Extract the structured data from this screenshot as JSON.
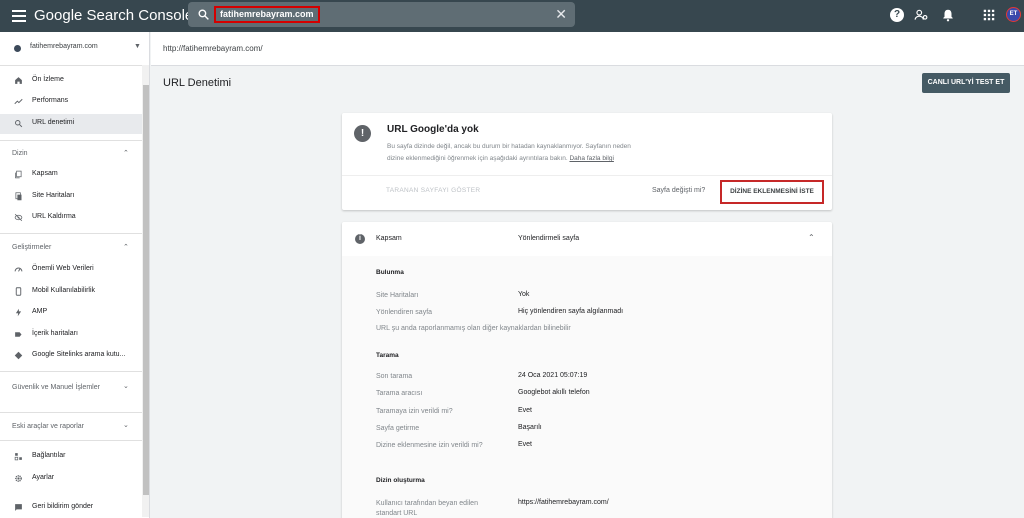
{
  "topbar": {
    "app_name": "Google Search Console",
    "search_value": "fatihemrebayram.com",
    "clear_symbol": "✕",
    "help_symbol": "?",
    "avatar_initials": "ET",
    "icons": [
      "menu-icon",
      "search-icon",
      "close-icon",
      "help-icon",
      "manage-users-icon",
      "notifications-icon",
      "apps-icon"
    ]
  },
  "sidebar": {
    "property": "fatihemrebayram.com",
    "property_caret": "▼",
    "top_items": [
      {
        "label": "Ön İzleme",
        "icon": "home-icon"
      },
      {
        "label": "Performans",
        "icon": "trending-up-icon"
      },
      {
        "label": "URL denetimi",
        "icon": "search-icon",
        "active": true
      }
    ],
    "section_index": "Dizin",
    "index_items": [
      {
        "label": "Kapsam",
        "icon": "file-copy-icon"
      },
      {
        "label": "Site Haritaları",
        "icon": "sitemap-icon"
      },
      {
        "label": "URL Kaldırma",
        "icon": "visibility-off-icon"
      }
    ],
    "section_enhancements": "Geliştirmeler",
    "enh_items": [
      {
        "label": "Önemli Web Verileri",
        "icon": "speed-icon"
      },
      {
        "label": "Mobil Kullanılabilirlik",
        "icon": "smartphone-icon"
      },
      {
        "label": "AMP",
        "icon": "bolt-icon"
      },
      {
        "label": "İçerik haritaları",
        "icon": "breadcrumb-icon"
      },
      {
        "label": "Google Sitelinks arama kutu...",
        "icon": "layers-icon"
      }
    ],
    "section_security": "Güvenlik ve Manuel İşlemler",
    "section_legacy": "Eski araçlar ve raporlar",
    "bottom_items": [
      {
        "label": "Bağlantılar",
        "icon": "links-icon"
      },
      {
        "label": "Ayarlar",
        "icon": "settings-icon"
      },
      {
        "label": "Geri bildirim gönder",
        "icon": "feedback-icon"
      }
    ],
    "chevron_up": "⌃",
    "chevron_down": "⌄"
  },
  "path": "http://fatihemrebayram.com/",
  "page_title": "URL Denetimi",
  "live_test_label": "CANLI URL'Yİ TEST ET",
  "status_card": {
    "icon_symbol": "!",
    "title": "URL Google'da yok",
    "desc_line1": "Bu sayfa dizinde değil, ancak bu durum bir hatadan kaynaklanmıyor. Sayfanın neden",
    "desc_line2": "dizine eklenmediğini öğrenmek için aşağıdaki ayrıntılara bakın.",
    "desc_link": "Daha fazla bilgi",
    "crawled_page_label": "TARANAN SAYFAYI GÖSTER",
    "page_changed_label": "Sayfa değişti mi?",
    "request_index_label": "DİZİNE EKLENMESİNİ İSTE"
  },
  "coverage": {
    "icon_symbol": "i",
    "label": "Kapsam",
    "value": "Yönlendirmeli sayfa",
    "chevron": "⌃",
    "discovery_title": "Bulunma",
    "discovery_rows": [
      {
        "k": "Site Haritaları",
        "v": "Yok"
      },
      {
        "k": "Yönlendiren sayfa",
        "v": "Hiç yönlendiren sayfa algılanmadı"
      }
    ],
    "discovery_note": "URL şu anda raporlanmamış olan diğer kaynaklardan bilinebilir",
    "crawl_title": "Tarama",
    "crawl_rows": [
      {
        "k": "Son tarama",
        "v": "24 Oca 2021 05:07:19"
      },
      {
        "k": "Tarama aracısı",
        "v": "Googlebot akıllı telefon"
      },
      {
        "k": "Taramaya izin verildi mi?",
        "v": "Evet"
      },
      {
        "k": "Sayfa getirme",
        "v": "Başarılı"
      },
      {
        "k": "Dizine eklenmesine izin verildi mi?",
        "v": "Evet"
      }
    ],
    "indexing_title": "Dizin oluşturma",
    "indexing_rows": [
      {
        "k": "Kullanıcı tarafından beyan edilen standart URL",
        "v": "https://fatihemrebayram.com/"
      }
    ]
  }
}
